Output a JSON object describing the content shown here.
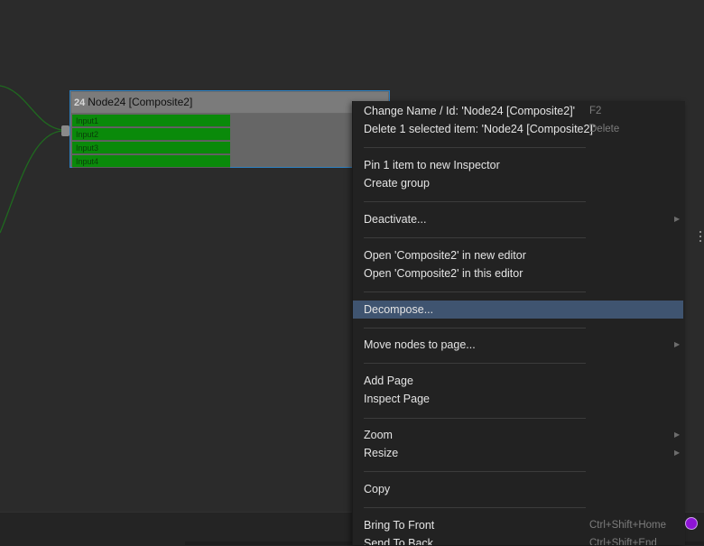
{
  "node": {
    "id": "24",
    "title": "Node24 [Composite2]",
    "inputs": [
      "Input1",
      "Input2",
      "Input3",
      "Input4"
    ]
  },
  "menu": {
    "change_name": {
      "label": "Change Name / Id: 'Node24 [Composite2]'",
      "shortcut": "F2"
    },
    "delete": {
      "label": "Delete 1 selected item: 'Node24 [Composite2]'",
      "shortcut": "Delete"
    },
    "pin": {
      "label": "Pin 1 item to new Inspector"
    },
    "create_group": {
      "label": "Create group"
    },
    "deactivate": {
      "label": "Deactivate..."
    },
    "open_new_editor": {
      "label": "Open 'Composite2' in new editor"
    },
    "open_this_editor": {
      "label": "Open 'Composite2' in this editor"
    },
    "decompose": {
      "label": "Decompose..."
    },
    "move_nodes": {
      "label": "Move nodes to page..."
    },
    "add_page": {
      "label": "Add Page"
    },
    "inspect_page": {
      "label": "Inspect Page"
    },
    "zoom": {
      "label": "Zoom"
    },
    "resize": {
      "label": "Resize"
    },
    "copy": {
      "label": "Copy"
    },
    "bring_to_front": {
      "label": "Bring To Front",
      "shortcut": "Ctrl+Shift+Home"
    },
    "send_to_back": {
      "label": "Send To Back",
      "shortcut": "Ctrl+Shift+End"
    }
  },
  "colors": {
    "highlight": "#3f5470",
    "input_green": "#0a8a0a",
    "selection_border": "#2d7fc0",
    "indicator": "#8e14d6"
  }
}
